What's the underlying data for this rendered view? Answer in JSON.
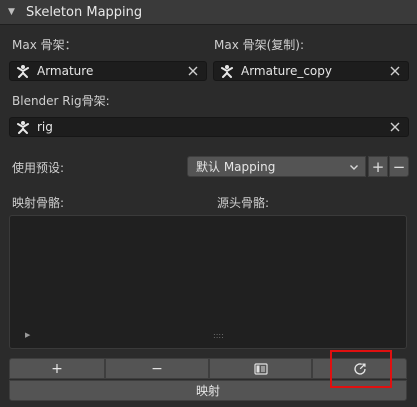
{
  "panel": {
    "title": "Skeleton Mapping"
  },
  "max_skeleton": {
    "label": "Max 骨架：",
    "value": "Armature"
  },
  "max_skeleton_copy": {
    "label": "Max 骨架(复制):",
    "value": "Armature_copy"
  },
  "blender_rig": {
    "label": "Blender Rig骨架:",
    "value": "rig"
  },
  "preset": {
    "label": "使用预设:",
    "selected": "默认 Mapping",
    "add_label": "+",
    "remove_label": "−"
  },
  "list": {
    "mapped_bones_label": "映射骨骼:",
    "source_bones_label": "源头骨骼:",
    "grip": "::::"
  },
  "toolbar": {
    "add_label": "+",
    "remove_label": "−"
  },
  "map_button": {
    "label": "映射"
  },
  "colors": {
    "highlight": "#e01010",
    "panel_bg": "#2b2b2b",
    "field_bg": "#1d1d1d",
    "button_bg": "#545454"
  }
}
